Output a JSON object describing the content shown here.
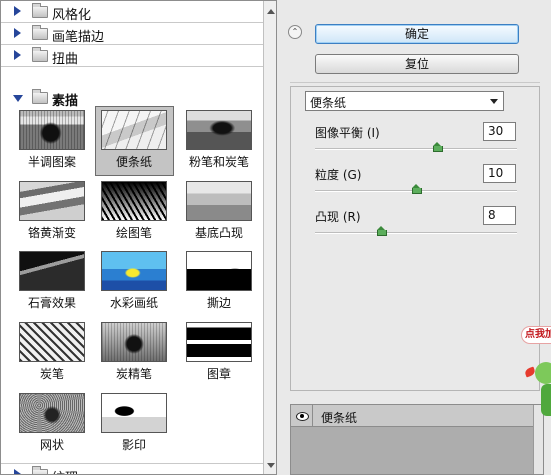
{
  "gallery": {
    "categories": [
      {
        "label": "风格化",
        "expanded": false
      },
      {
        "label": "画笔描边",
        "expanded": false
      },
      {
        "label": "扭曲",
        "expanded": false
      },
      {
        "label": "素描",
        "expanded": true
      },
      {
        "label": "纹理",
        "expanded": false
      }
    ],
    "filters": [
      {
        "label": "半调图案",
        "icon": "halftone-pattern-thumbnail"
      },
      {
        "label": "便条纸",
        "icon": "note-paper-thumbnail",
        "selected": true
      },
      {
        "label": "粉笔和炭笔",
        "icon": "chalk-charcoal-thumbnail"
      },
      {
        "label": "铬黄渐变",
        "icon": "chrome-thumbnail"
      },
      {
        "label": "绘图笔",
        "icon": "graphic-pen-thumbnail"
      },
      {
        "label": "基底凸现",
        "icon": "bas-relief-thumbnail"
      },
      {
        "label": "石膏效果",
        "icon": "plaster-thumbnail"
      },
      {
        "label": "水彩画纸",
        "icon": "water-paper-thumbnail"
      },
      {
        "label": "撕边",
        "icon": "torn-edges-thumbnail"
      },
      {
        "label": "炭笔",
        "icon": "charcoal-thumbnail"
      },
      {
        "label": "炭精笔",
        "icon": "conte-crayon-thumbnail"
      },
      {
        "label": "图章",
        "icon": "stamp-thumbnail"
      },
      {
        "label": "网状",
        "icon": "reticulation-thumbnail"
      },
      {
        "label": "影印",
        "icon": "photocopy-thumbnail"
      }
    ]
  },
  "buttons": {
    "ok": "确定",
    "reset": "复位"
  },
  "settings": {
    "filter_select": "便条纸",
    "params": [
      {
        "label": "图像平衡 (I)",
        "value": "30",
        "fraction": 0.61
      },
      {
        "label": "粒度 (G)",
        "value": "10",
        "fraction": 0.5
      },
      {
        "label": "凸现 (R)",
        "value": "8",
        "fraction": 0.32
      }
    ]
  },
  "layers": {
    "items": [
      {
        "name": "便条纸",
        "visible": true
      }
    ]
  },
  "ad_badge": "点我加",
  "colors": {
    "accent_blue": "#26469a",
    "slider_green": "#5cae5c",
    "badge_red": "#c2161b"
  }
}
